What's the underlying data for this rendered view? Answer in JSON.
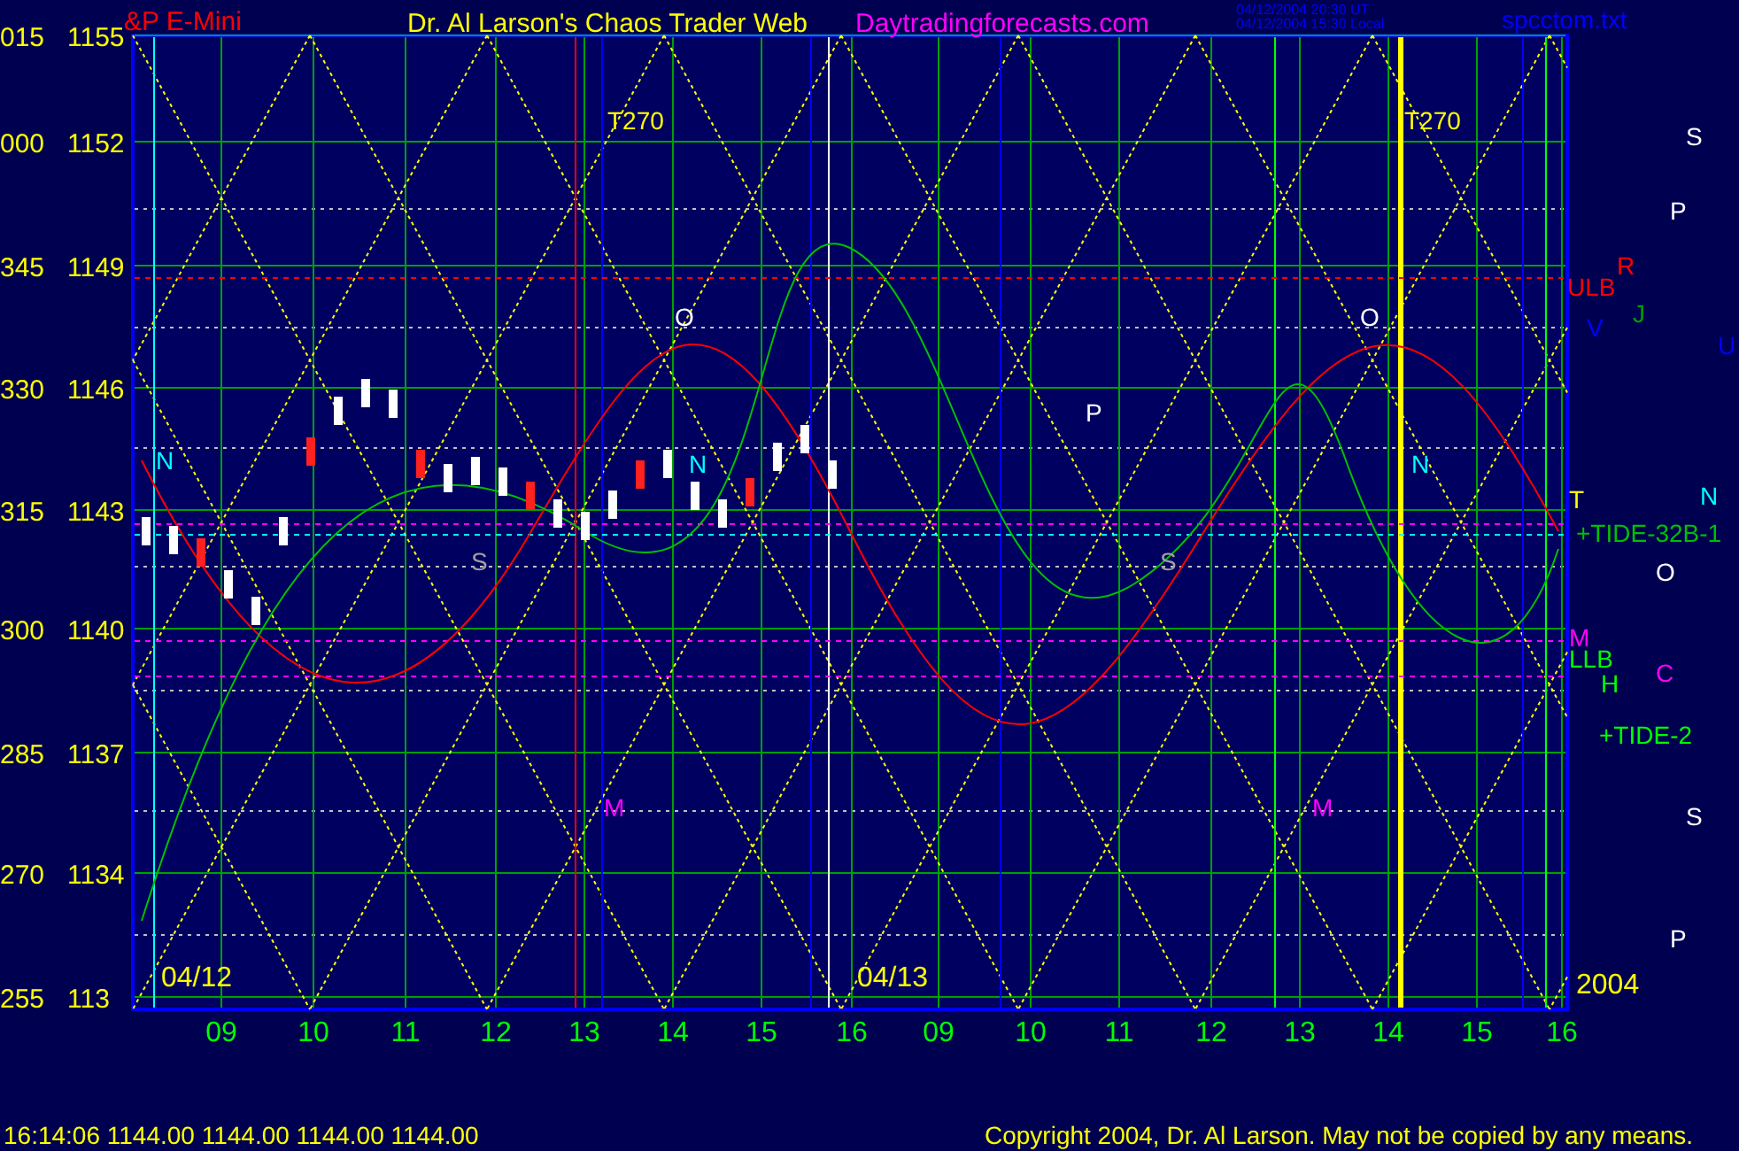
{
  "header": {
    "instrument": "&P E-Mini",
    "title": "Dr. Al Larson's Chaos Trader Web",
    "site": "Daytradingforecasts.com",
    "timestamps": [
      "04/12/2004 20:30 UT",
      "04/12/2004 15:30 Local"
    ],
    "file": "spcctom.txt"
  },
  "y_axis": [
    {
      "angle": "015",
      "price": "1155"
    },
    {
      "angle": "000",
      "price": "1152"
    },
    {
      "angle": "345",
      "price": "1149"
    },
    {
      "angle": "330",
      "price": "1146"
    },
    {
      "angle": "315",
      "price": "1143"
    },
    {
      "angle": "300",
      "price": "1140"
    },
    {
      "angle": "285",
      "price": "1137"
    },
    {
      "angle": "270",
      "price": "1134"
    },
    {
      "angle": "255",
      "price": "113"
    }
  ],
  "dates": [
    "04/12",
    "04/13",
    "2004"
  ],
  "x_axis": [
    "09",
    "10",
    "11",
    "12",
    "13",
    "14",
    "15",
    "16",
    "09",
    "10",
    "11",
    "12",
    "13",
    "14",
    "15",
    "16"
  ],
  "annotations": [
    {
      "text": "T270",
      "color": "#ffff00"
    },
    {
      "text": "T270",
      "color": "#ffff00"
    },
    {
      "text": "O",
      "color": "#ffffff"
    },
    {
      "text": "O",
      "color": "#ffffff"
    },
    {
      "text": "N",
      "color": "#00ffff"
    },
    {
      "text": "N",
      "color": "#00ffff"
    },
    {
      "text": "N",
      "color": "#00ffff"
    },
    {
      "text": "P",
      "color": "#ffffff"
    },
    {
      "text": "S",
      "color": "#a0a0a0"
    },
    {
      "text": "S",
      "color": "#a0a0a0"
    },
    {
      "text": "M",
      "color": "#ff00ff"
    },
    {
      "text": "M",
      "color": "#ff00ff"
    },
    {
      "text": "ULB",
      "color": "#ff0000"
    },
    {
      "text": "R",
      "color": "#ff0000"
    },
    {
      "text": "V",
      "color": "#0000ff"
    },
    {
      "text": "J",
      "color": "#00a000"
    },
    {
      "text": "U",
      "color": "#0000ff"
    },
    {
      "text": "T",
      "color": "#ffff00"
    },
    {
      "text": "N",
      "color": "#00ffff"
    },
    {
      "text": "+TIDE-32B-1",
      "color": "#00c000"
    },
    {
      "text": "O",
      "color": "#ffffff"
    },
    {
      "text": "M",
      "color": "#ff00ff"
    },
    {
      "text": "LLB",
      "color": "#00ff00"
    },
    {
      "text": "H",
      "color": "#00ff00"
    },
    {
      "text": "C",
      "color": "#ff00ff"
    },
    {
      "text": "+TIDE-2",
      "color": "#00ff00"
    },
    {
      "text": "S",
      "color": "#ffffff"
    },
    {
      "text": "P",
      "color": "#ffffff"
    },
    {
      "text": "S",
      "color": "#ffffff"
    },
    {
      "text": "P",
      "color": "#ffffff"
    }
  ],
  "footer": {
    "quote": "16:14:06  1144.00 1144.00 1144.00 1144.00",
    "copyright": "Copyright 2004, Dr. Al Larson. May not be copied by any means."
  }
}
